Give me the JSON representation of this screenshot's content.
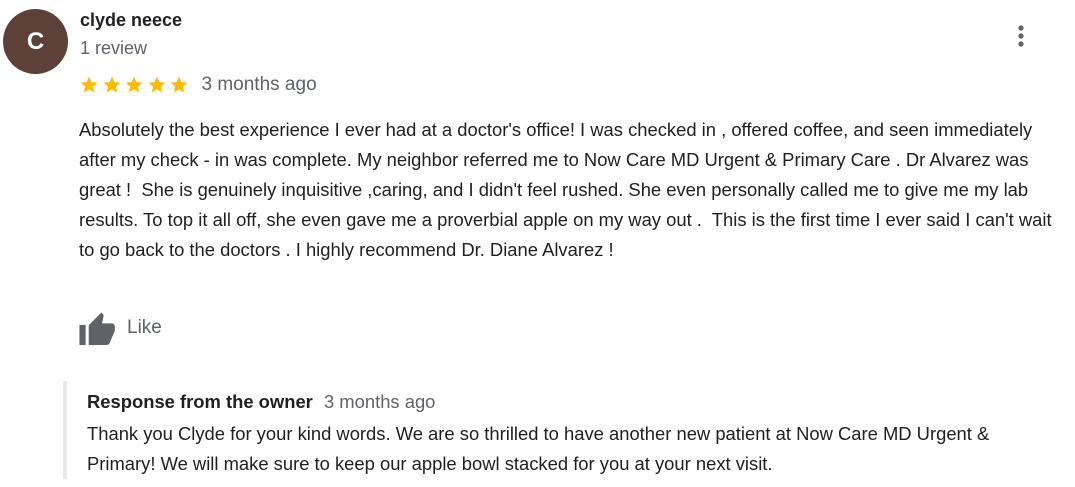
{
  "review": {
    "avatar_initial": "C",
    "avatar_color": "#5d4037",
    "reviewer_name": "clyde neece",
    "review_count": "1 review",
    "rating": 5,
    "max_rating": 5,
    "star_color": "#fbbc04",
    "time": "3 months ago",
    "text": "Absolutely the best experience I ever had at a doctor's office! I was checked in , offered coffee, and seen immediately after my check - in was complete. My neighbor referred me to Now Care MD Urgent & Primary Care . Dr Alvarez was great !  She is genuinely inquisitive ,caring, and I didn't feel rushed. She even personally called me to give me my lab results. To top it all off, she even gave me a proverbial apple on my way out .  This is the first time I ever said I can't wait to go back to the doctors . I highly recommend Dr. Diane Alvarez !",
    "like_label": "Like",
    "icons": {
      "more": "more-vert-icon",
      "like": "thumb-up-icon",
      "star": "star-icon"
    }
  },
  "owner_response": {
    "title": "Response from the owner",
    "time": "3 months ago",
    "text": "Thank you Clyde for your kind words. We are so thrilled to have another new patient at Now Care MD Urgent & Primary! We will make sure to keep our apple bowl stacked for you at your next visit."
  }
}
